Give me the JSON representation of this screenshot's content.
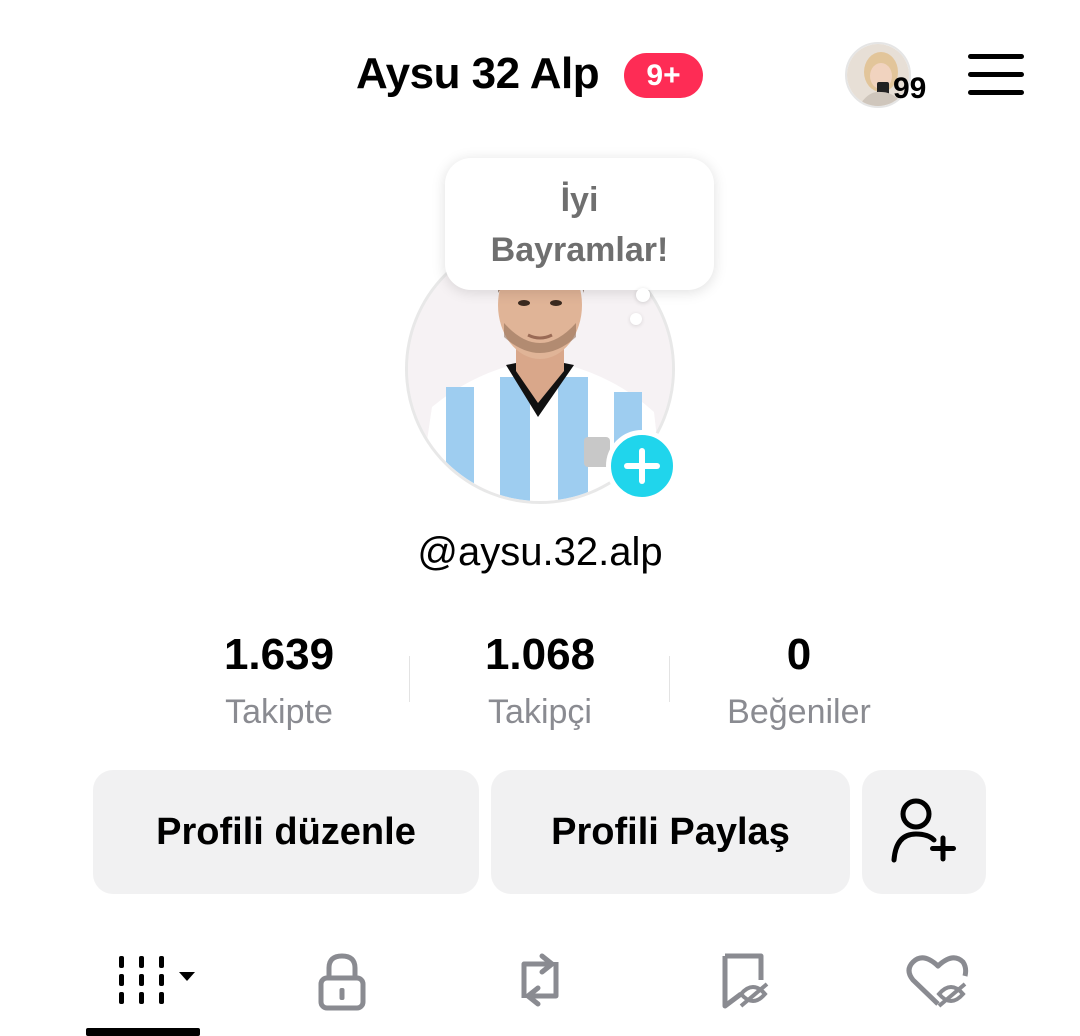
{
  "header": {
    "title": "Aysu 32 Alp",
    "notification_badge": "9+",
    "account_switch_count": "99",
    "menu_icon": "hamburger-menu-icon"
  },
  "profile": {
    "note_line1": "İyi",
    "note_line2": "Bayramlar!",
    "username": "@aysu.32.alp",
    "add_icon": "plus-icon"
  },
  "stats": [
    {
      "value": "1.639",
      "label": "Takipte"
    },
    {
      "value": "1.068",
      "label": "Takipçi"
    },
    {
      "value": "0",
      "label": "Beğeniler"
    }
  ],
  "actions": {
    "edit_profile": "Profili düzenle",
    "share_profile": "Profili Paylaş",
    "add_friend_icon": "add-user-icon"
  },
  "tabs": [
    {
      "icon": "grid-videos-icon",
      "active": true
    },
    {
      "icon": "lock-icon"
    },
    {
      "icon": "repost-icon"
    },
    {
      "icon": "bookmark-hidden-icon"
    },
    {
      "icon": "liked-hidden-icon"
    }
  ],
  "colors": {
    "badge": "#fe2c55",
    "add_button": "#20d5ec",
    "button_bg": "#f1f1f2",
    "secondary_text": "#8a8b91"
  }
}
